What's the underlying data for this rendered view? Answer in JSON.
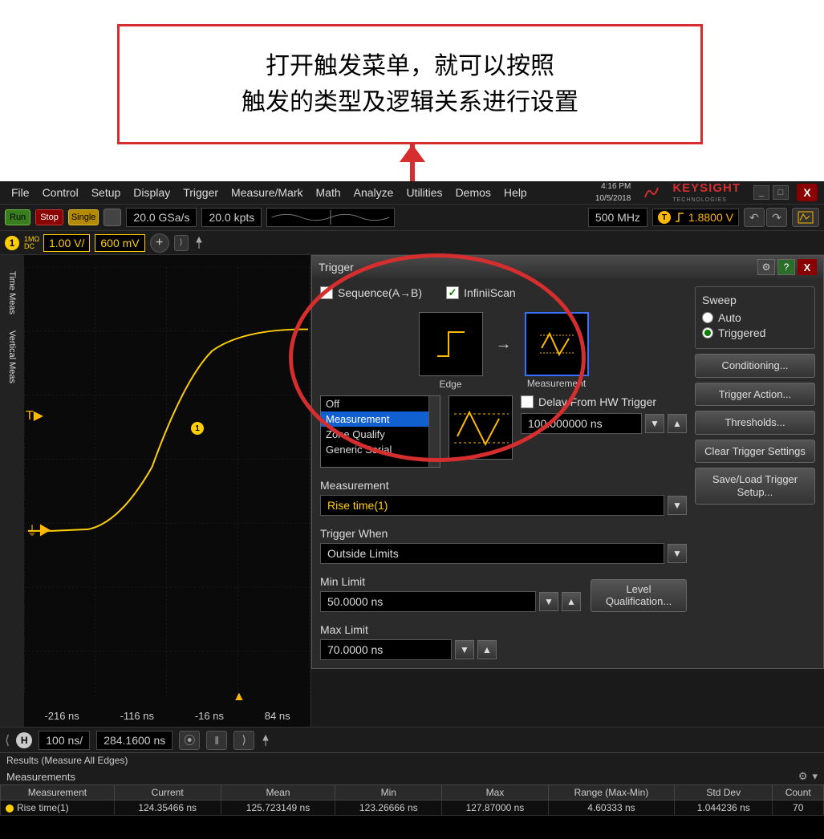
{
  "callout": "打开触发菜单，就可以按照\n触发的类型及逻辑关系进行设置",
  "menubar": [
    "File",
    "Control",
    "Setup",
    "Display",
    "Trigger",
    "Measure/Mark",
    "Math",
    "Analyze",
    "Utilities",
    "Demos",
    "Help"
  ],
  "time": "4:16 PM",
  "date": "10/5/2018",
  "brand": "KEYSIGHT",
  "brand_sub": "TECHNOLOGIES",
  "toolbar": {
    "run": "Run",
    "stop": "Stop",
    "single": "Single",
    "sample_rate": "20.0 GSa/s",
    "mem_depth": "20.0 kpts",
    "bw": "500 MHz",
    "trig_level": "1.8800 V"
  },
  "channel": {
    "num": "1",
    "dc": "1MΩ DC",
    "scale": "1.00 V/",
    "offset": "600 mV"
  },
  "left_rail": [
    "Time Meas",
    "Vertical Meas"
  ],
  "xaxis": [
    "-216 ns",
    "-116 ns",
    "-16 ns",
    "84 ns"
  ],
  "trigger": {
    "title": "Trigger",
    "seq_label": "Sequence(A→B)",
    "seq_checked": false,
    "infiniiscan_label": "InfiniiScan",
    "infiniiscan_checked": true,
    "flow_a": "Edge",
    "flow_b": "Measurement",
    "modes": [
      "Off",
      "Measurement",
      "Zone Qualify",
      "Generic Serial"
    ],
    "mode_selected": "Measurement",
    "delay_label": "Delay From HW Trigger",
    "delay_checked": false,
    "delay_value": "100.000000 ns",
    "measurement_label": "Measurement",
    "measurement_value": "Rise time(1)",
    "trigger_when_label": "Trigger When",
    "trigger_when_value": "Outside Limits",
    "min_label": "Min Limit",
    "min_value": "50.0000 ns",
    "max_label": "Max Limit",
    "max_value": "70.0000 ns",
    "level_btn": "Level Qualification...",
    "sweep": {
      "title": "Sweep",
      "auto": "Auto",
      "triggered": "Triggered",
      "selected": "Triggered"
    },
    "side_buttons": [
      "Conditioning...",
      "Trigger Action...",
      "Thresholds...",
      "Clear Trigger Settings",
      "Save/Load Trigger Setup..."
    ]
  },
  "hbar": {
    "scale": "100 ns/",
    "pos": "284.1600 ns"
  },
  "results_title": "Results  (Measure All Edges)",
  "meas_title": "Measurements",
  "table": {
    "headers": [
      "Measurement",
      "Current",
      "Mean",
      "Min",
      "Max",
      "Range (Max-Min)",
      "Std Dev",
      "Count"
    ],
    "row": {
      "name": "Rise time(1)",
      "current": "124.35466 ns",
      "mean": "125.723149 ns",
      "min": "123.26666 ns",
      "max": "127.87000 ns",
      "range": "4.60333 ns",
      "stddev": "1.044236 ns",
      "count": "70"
    }
  }
}
